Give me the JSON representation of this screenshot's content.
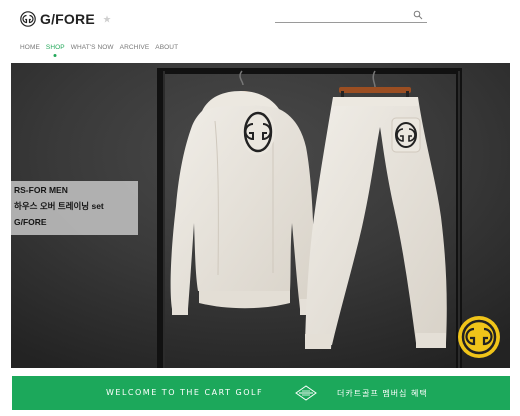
{
  "brand": {
    "name": "G/FORE"
  },
  "search": {
    "value": "",
    "placeholder": ""
  },
  "nav": {
    "items": [
      "HOME",
      "SHOP",
      "WHAT'S NOW",
      "ARCHIVE",
      "ABOUT"
    ],
    "active": "SHOP"
  },
  "hero": {
    "caption": {
      "line1": "RS-FOR MEN",
      "line2": "하우스 오버 트레이닝 set",
      "line3": "G/FORE"
    }
  },
  "banner": {
    "left_text": "WELCOME TO THE CART GOLF",
    "right_text": "더카트골프 멤버십 혜택"
  },
  "colors": {
    "accent_green": "#1ca85b",
    "nav_active": "#23a85a",
    "text_dark": "#222222",
    "hero_background": "#393939",
    "garment": "#e9e5de",
    "badge_yellow": "#f0c419"
  },
  "icons": {
    "logo_mark": "gfore-logo-icon",
    "favorite": "star-icon",
    "search": "search-icon",
    "banner_logo": "gfore-banner-logo-icon"
  }
}
